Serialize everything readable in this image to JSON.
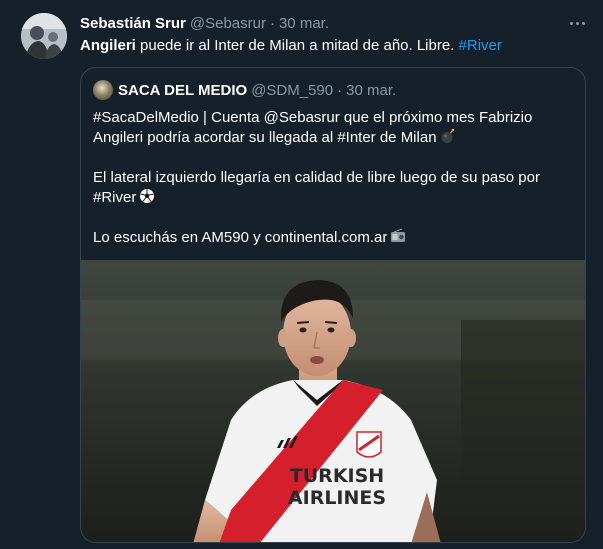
{
  "tweet": {
    "author_name": "Sebastián Srur",
    "author_handle": "@Sebasrur",
    "separator": "·",
    "date": "30 mar.",
    "text_bold": "Angileri",
    "text_main": " puede ir al Inter de Milan a mitad de año. Libre. ",
    "text_hashtag": "#River"
  },
  "quote": {
    "author_name": "SACA DEL MEDIO",
    "author_handle": "@SDM_590",
    "separator": "·",
    "date": "30 mar.",
    "line1": "#SacaDelMedio | Cuenta @Sebasrur que el próximo mes Fabrizio",
    "line2": "Angileri podría acordar su llegada al #Inter de Milan",
    "line3": "El lateral izquierdo llegaría en calidad de libre luego de su paso por",
    "line4": "#River",
    "line5": "Lo escuchás en AM590 y continental.com.ar",
    "image": {
      "shirt_sponsor_line1": "TURKISH",
      "shirt_sponsor_line2": "AIRLINES"
    }
  },
  "icons": {
    "more": "more-dots-icon",
    "bomb": "bomb-emoji-icon",
    "ball": "soccer-ball-emoji-icon",
    "radio": "radio-emoji-icon"
  },
  "colors": {
    "background": "#15202b",
    "border": "#38444d",
    "muted": "#8b98a5",
    "link": "#1d9bf0",
    "jersey_red": "#d61f2c"
  }
}
